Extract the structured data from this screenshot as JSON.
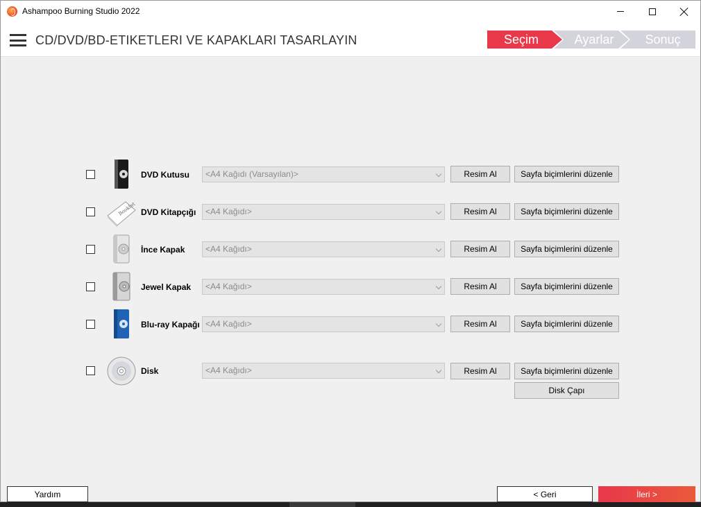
{
  "window": {
    "title": "Ashampoo Burning Studio 2022",
    "icon": "ashampoo-flame-icon",
    "controls": [
      "minimize-icon",
      "maximize-icon",
      "close-icon"
    ]
  },
  "header": {
    "menu_icon": "hamburger-menu-icon",
    "title": "CD/DVD/BD-ETIKETLERI VE KAPAKLARI TASARLAYIN",
    "steps": [
      {
        "label": "Seçim",
        "active": true
      },
      {
        "label": "Ayarlar",
        "active": false
      },
      {
        "label": "Sonuç",
        "active": false
      }
    ]
  },
  "rows": [
    {
      "label": "DVD Kutusu",
      "icon": "dvd-box-icon",
      "paper": "<A4 Kağıdı (Varsayılan)>",
      "image_button": "Resim Al",
      "layout_button": "Sayfa biçimlerini düzenle",
      "checked": false
    },
    {
      "label": "DVD Kitapçığı",
      "icon": "booklet-icon",
      "paper": "<A4 Kağıdı>",
      "image_button": "Resim Al",
      "layout_button": "Sayfa biçimlerini düzenle",
      "checked": false
    },
    {
      "label": "İnce Kapak",
      "icon": "slim-case-icon",
      "paper": "<A4 Kağıdı>",
      "image_button": "Resim Al",
      "layout_button": "Sayfa biçimlerini düzenle",
      "checked": false
    },
    {
      "label": "Jewel Kapak",
      "icon": "jewel-case-icon",
      "paper": "<A4 Kağıdı>",
      "image_button": "Resim Al",
      "layout_button": "Sayfa biçimlerini düzenle",
      "checked": false
    },
    {
      "label": "Blu-ray Kapağı",
      "icon": "bluray-case-icon",
      "paper": "<A4 Kağıdı>",
      "image_button": "Resim Al",
      "layout_button": "Sayfa biçimlerini düzenle",
      "checked": false
    },
    {
      "label": "Disk",
      "icon": "disc-icon",
      "paper": "<A4 Kağıdı>",
      "image_button": "Resim Al",
      "layout_button": "Sayfa biçimlerini düzenle",
      "checked": false
    }
  ],
  "disk_diameter_button": "Disk Çapı",
  "footer": {
    "help": "Yardım",
    "back": "< Geri",
    "next": "İleri >"
  },
  "colors": {
    "accent": "#e8384a",
    "step_inactive": "#d3d3db",
    "bluray": "#1f64b4"
  }
}
